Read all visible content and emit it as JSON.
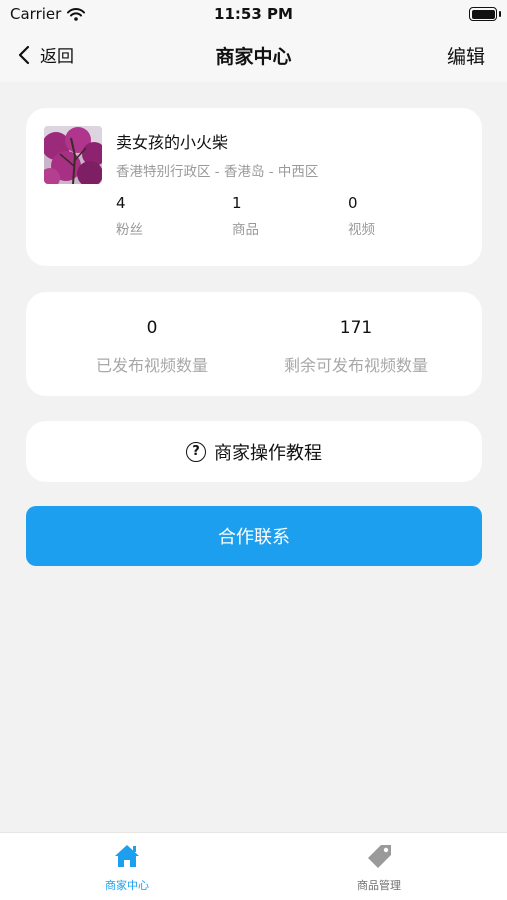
{
  "status_bar": {
    "carrier": "Carrier",
    "time": "11:53 PM"
  },
  "nav": {
    "back_label": "返回",
    "title": "商家中心",
    "edit_label": "编辑"
  },
  "profile": {
    "name": "卖女孩的小火柴",
    "location": "香港特别行政区 - 香港岛 - 中西区",
    "stats": [
      {
        "value": "4",
        "label": "粉丝"
      },
      {
        "value": "1",
        "label": "商品"
      },
      {
        "value": "0",
        "label": "视频"
      }
    ]
  },
  "quota": {
    "published": {
      "value": "0",
      "label": "已发布视频数量"
    },
    "remaining": {
      "value": "171",
      "label": "剩余可发布视频数量"
    }
  },
  "tutorial": {
    "label": "商家操作教程",
    "icon": "help-circle-icon"
  },
  "contact": {
    "label": "合作联系"
  },
  "tabs": [
    {
      "label": "商家中心",
      "icon": "home-icon",
      "active": true
    },
    {
      "label": "商品管理",
      "icon": "tag-icon",
      "active": false
    }
  ],
  "colors": {
    "accent": "#1d9ff0",
    "background": "#f2f2f2",
    "muted_text": "#9a9a9a"
  }
}
